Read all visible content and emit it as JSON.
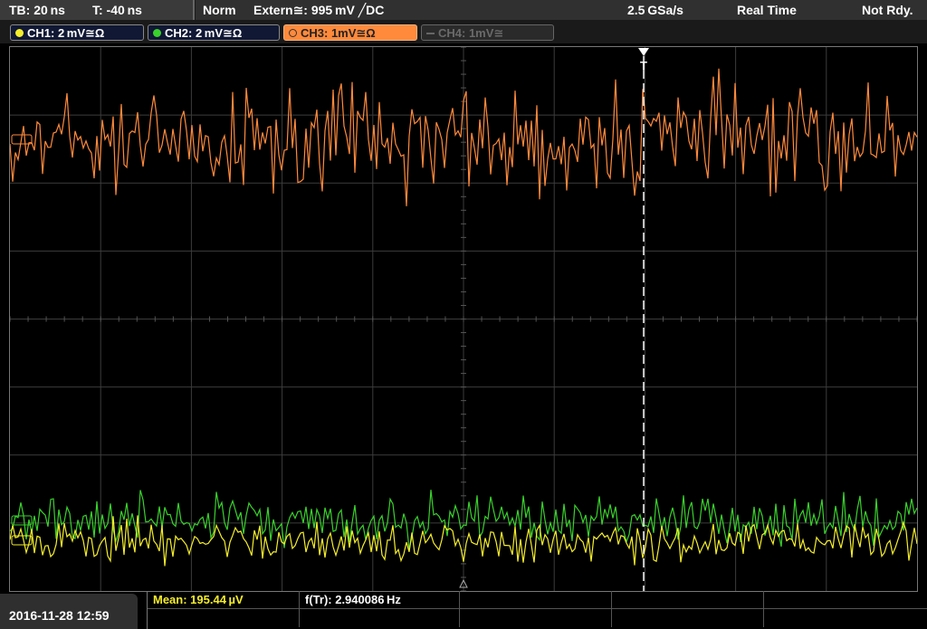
{
  "topbar": {
    "timebase": "TB: 20 ns",
    "trigger_time": "T: -40 ns",
    "mode": "Norm",
    "trigger_source": "Extern≅: 995 mV ╱DC",
    "sample_rate": "2.5 GSa/s",
    "acq_mode": "Real Time",
    "status": "Not Rdy."
  },
  "channels": [
    {
      "label": "CH1: 2 mV≅Ω",
      "color": "#f5ee2a",
      "active": true
    },
    {
      "label": "CH2: 2 mV≅Ω",
      "color": "#39d12c",
      "active": true
    },
    {
      "label": "CH3: 1mV≅Ω",
      "color": "#ff8a3c",
      "active": true
    },
    {
      "label": "CH4: 1mV≅",
      "color": "#777777",
      "active": false
    }
  ],
  "trigger_marker": "T",
  "timestamp": "2016-11-28 12:59",
  "measurements": {
    "mean_label": "Mean: 195.44 µV",
    "freq_label": "f(Tr): 2.940086 Hz"
  },
  "colors": {
    "ch1": "#f5ee2a",
    "ch2": "#39d12c",
    "ch3": "#ff8a3c",
    "grid": "#4a4a4a",
    "mean_text": "#f5ee2a"
  }
}
